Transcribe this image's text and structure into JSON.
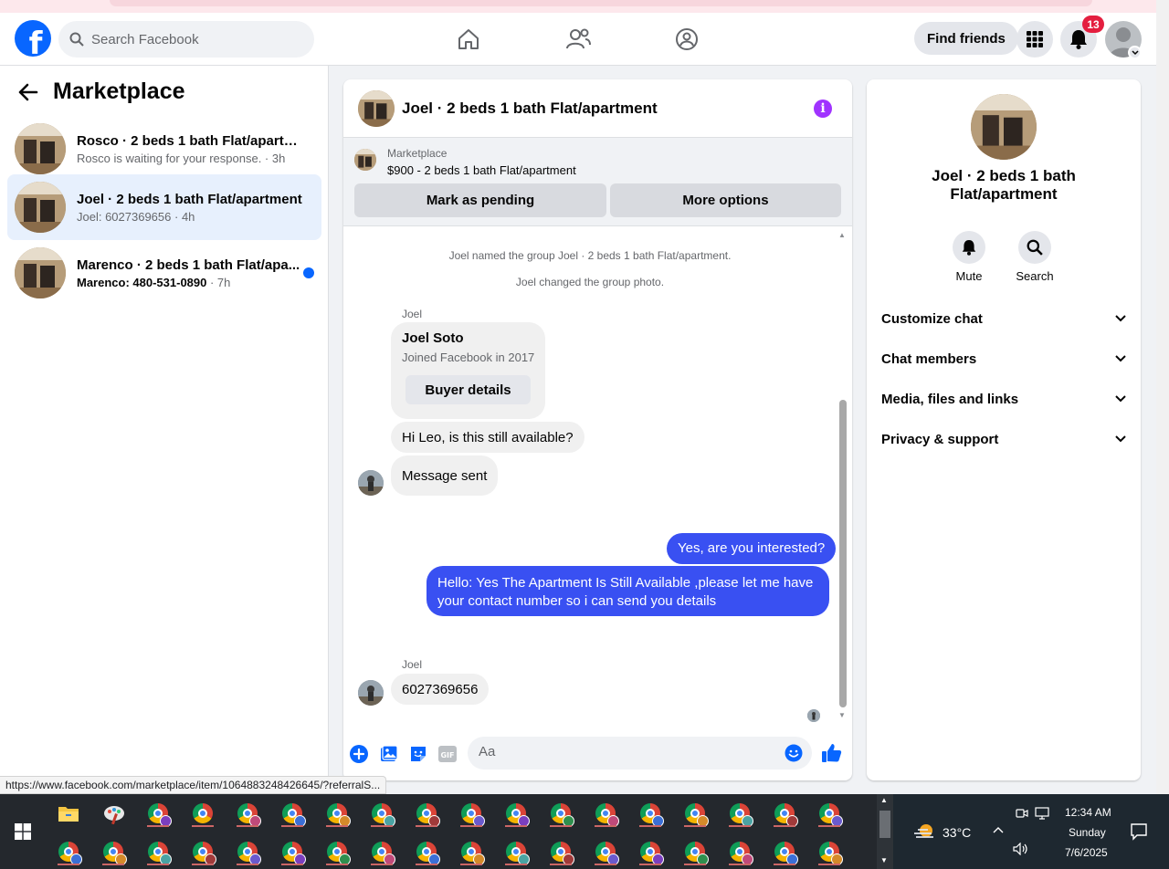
{
  "topnav": {
    "search_placeholder": "Search Facebook",
    "find_friends_label": "Find friends",
    "notification_count": "13"
  },
  "sidebar": {
    "title": "Marketplace",
    "conversations": [
      {
        "title": "Rosco · 2 beds 1 bath Flat/apartme...",
        "preview": "Rosco is waiting for your response.",
        "time": "3h",
        "active": false,
        "unread": false
      },
      {
        "title": "Joel · 2 beds 1 bath Flat/apartment",
        "preview": "Joel: 6027369656",
        "time": "4h",
        "active": true,
        "unread": false
      },
      {
        "title": "Marenco · 2 beds 1 bath Flat/apa...",
        "preview": "Marenco: 480-531-0890",
        "time": "7h",
        "active": false,
        "unread": true
      }
    ]
  },
  "chat": {
    "title": "Joel · 2 beds 1 bath Flat/apartment",
    "listing": {
      "label": "Marketplace",
      "price_title": "$900 - 2 beds 1 bath Flat/apartment",
      "mark_pending_label": "Mark as pending",
      "more_options_label": "More options"
    },
    "system_messages": [
      "Joel named the group Joel · 2 beds 1 bath Flat/apartment.",
      "Joel changed the group photo."
    ],
    "sender_name": "Joel",
    "profile_card": {
      "name": "Joel Soto",
      "joined": "Joined Facebook in 2017",
      "button_label": "Buyer details"
    },
    "incoming_1": "Hi Leo, is this still available?",
    "incoming_2": "Message sent",
    "outgoing_1": "Yes, are you interested?",
    "outgoing_2": "Hello: Yes The Apartment Is Still Available ,please let me have your contact number so i can send you details",
    "sender_name_2": "Joel",
    "incoming_3": "6027369656",
    "composer_placeholder": "Aa"
  },
  "details": {
    "title": "Joel · 2 beds 1 bath Flat/apartment",
    "mute_label": "Mute",
    "search_label": "Search",
    "sections": [
      "Customize chat",
      "Chat members",
      "Media, files and links",
      "Privacy & support"
    ]
  },
  "status_link": "https://www.facebook.com/marketplace/item/1064883248426645/?referralS...",
  "taskbar": {
    "temperature": "33°C",
    "time": "12:34 AM",
    "day": "Sunday",
    "date": "7/6/2025"
  },
  "colors": {
    "brand_blue": "#0866ff",
    "outgoing_bubble": "#3950f2",
    "active_conversation": "#e7f0fd",
    "notification_red": "#e41e3f",
    "info_purple": "#a033ff"
  },
  "icons": [
    "search-icon",
    "home-icon",
    "friends-icon",
    "groups-icon",
    "menu-grid-icon",
    "bell-icon",
    "back-arrow-icon",
    "info-icon",
    "plus-icon",
    "photo-icon",
    "sticker-icon",
    "gif-icon",
    "emoji-icon",
    "like-icon",
    "chevron-down-icon",
    "windows-icon"
  ]
}
